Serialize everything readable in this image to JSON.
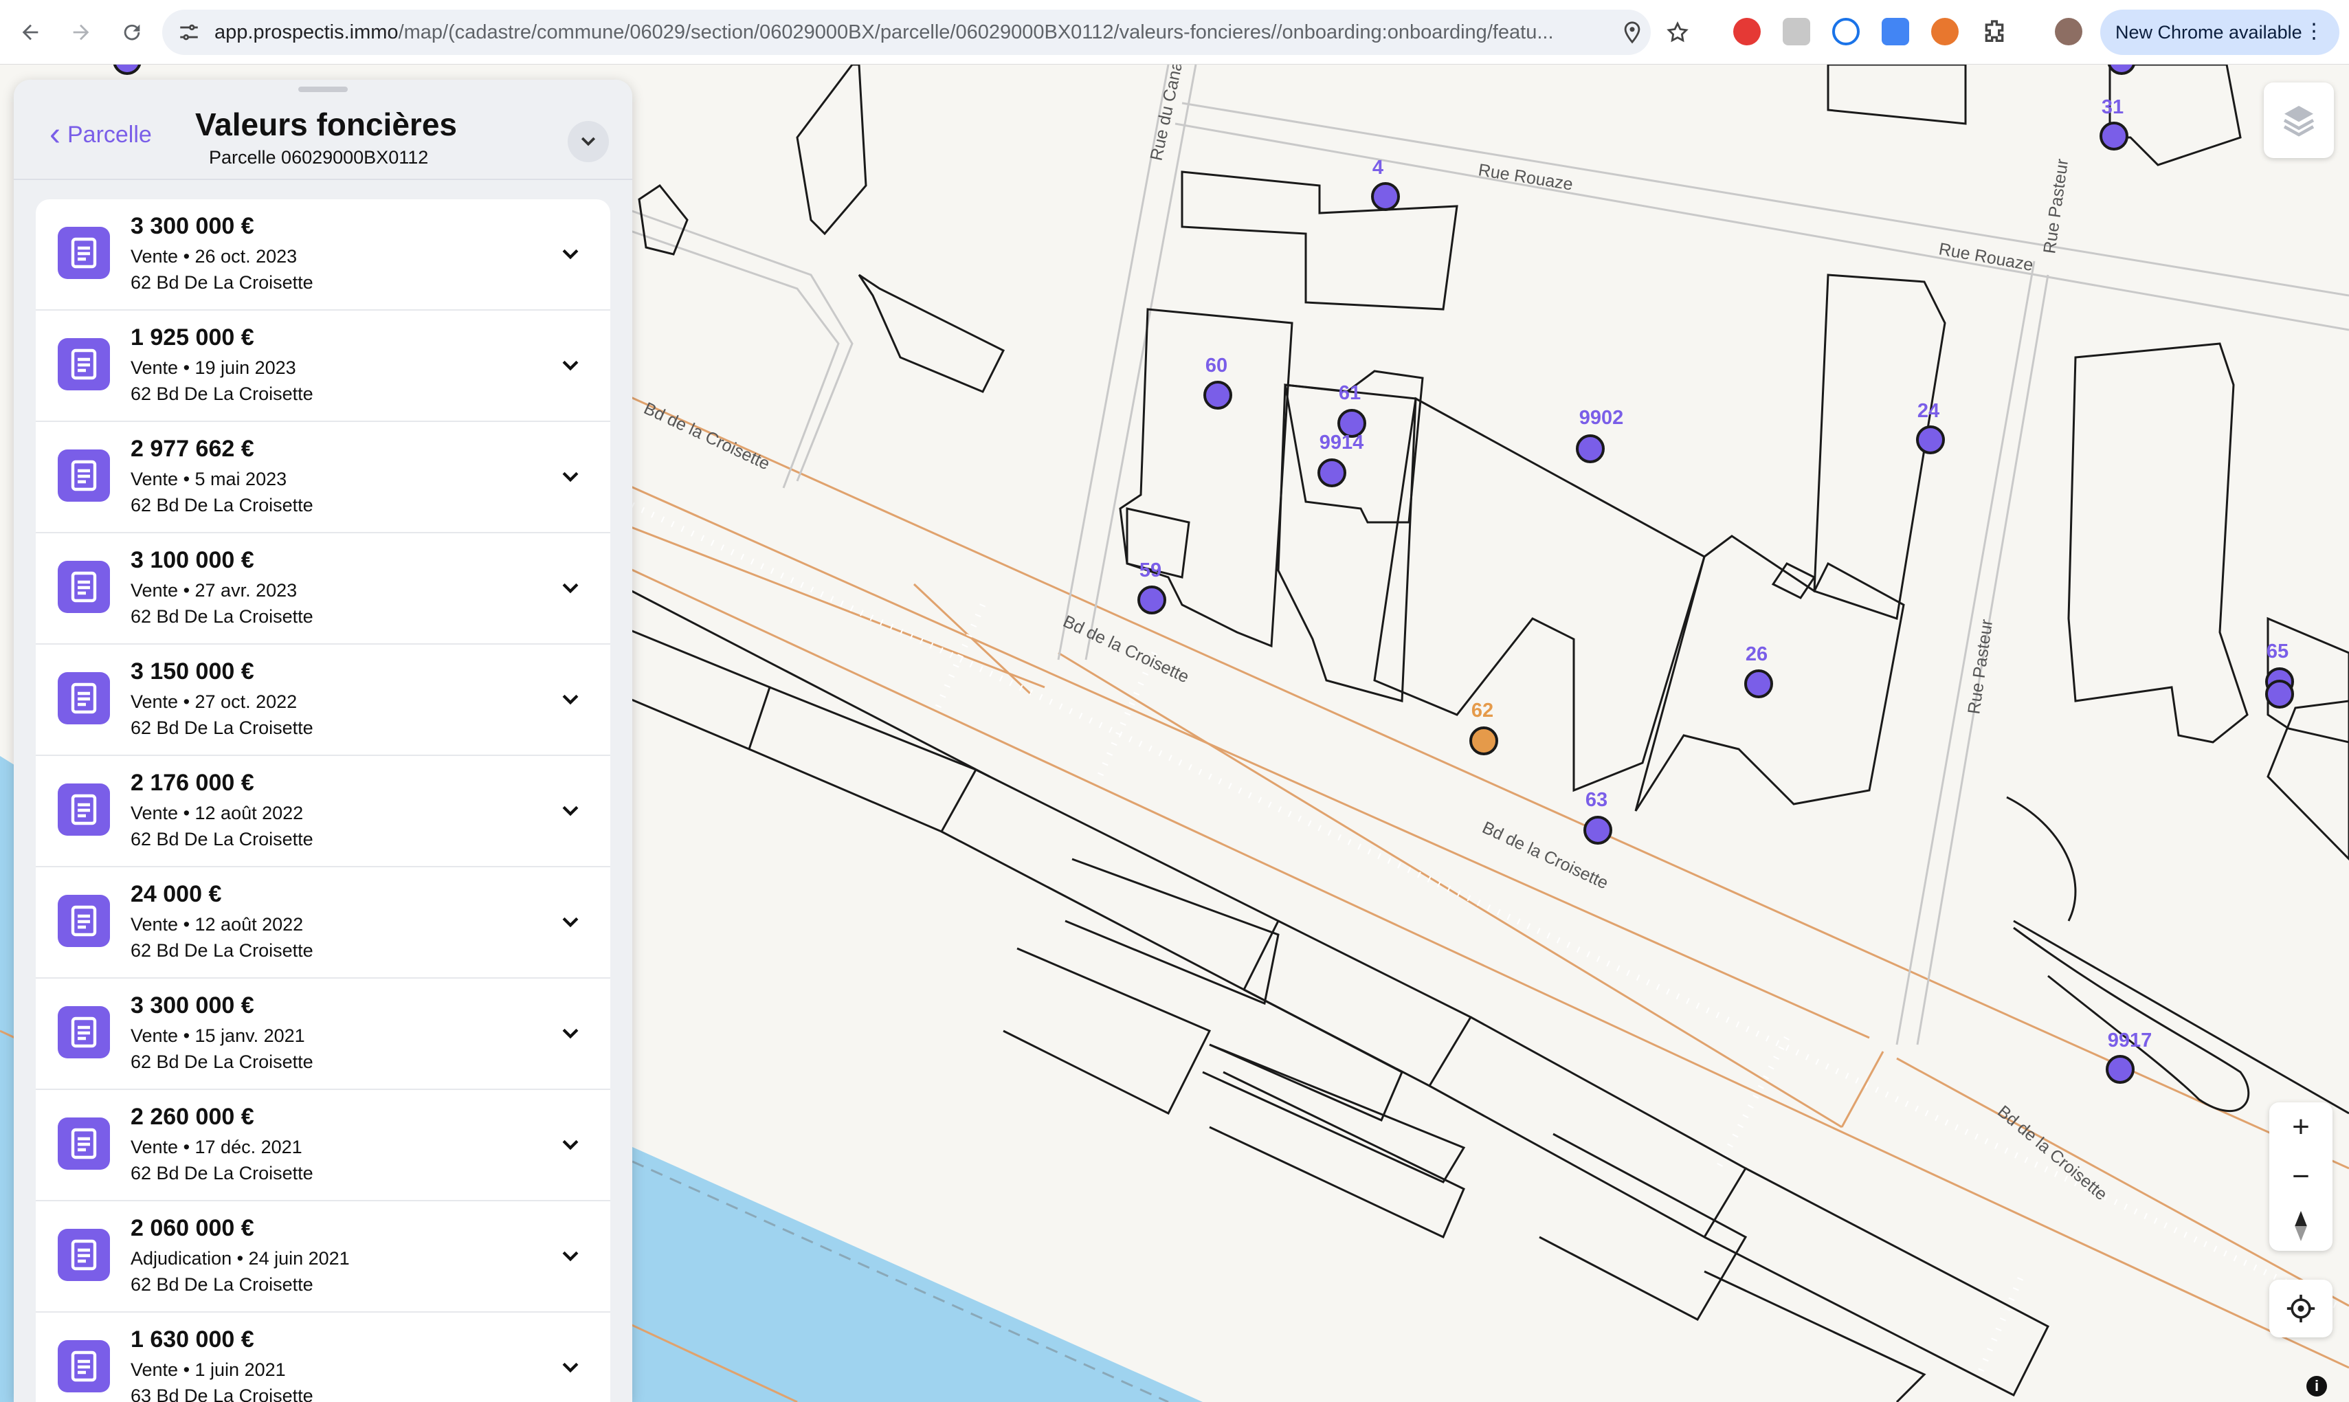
{
  "browser": {
    "url_host": "app.prospectis.immo",
    "url_path": "/map/(cadastre/commune/06029/section/06029000BX/parcelle/06029000BX0112/valeurs-foncieres//onboarding:onboarding/featu...",
    "update_label": "New Chrome available",
    "icons": [
      "back-arrow-icon",
      "forward-arrow-icon",
      "reload-icon",
      "site-settings-icon",
      "location-icon",
      "star-icon",
      "extension-icons",
      "puzzle-icon",
      "profile-avatar",
      "menu-dots-icon"
    ]
  },
  "panel": {
    "back_label": "Parcelle",
    "title": "Valeurs foncières",
    "subtitle": "Parcelle 06029000BX0112",
    "accent_color": "#7a5ee8",
    "transactions": [
      {
        "price": "3 300 000 €",
        "meta": "Vente • 26 oct. 2023",
        "address": "62 Bd De La Croisette"
      },
      {
        "price": "1 925 000 €",
        "meta": "Vente • 19 juin 2023",
        "address": "62 Bd De La Croisette"
      },
      {
        "price": "2 977 662 €",
        "meta": "Vente • 5 mai 2023",
        "address": "62 Bd De La Croisette"
      },
      {
        "price": "3 100 000 €",
        "meta": "Vente • 27 avr. 2023",
        "address": "62 Bd De La Croisette"
      },
      {
        "price": "3 150 000 €",
        "meta": "Vente • 27 oct. 2022",
        "address": "62 Bd De La Croisette"
      },
      {
        "price": "2 176 000 €",
        "meta": "Vente • 12 août 2022",
        "address": "62 Bd De La Croisette"
      },
      {
        "price": "24 000 €",
        "meta": "Vente • 12 août 2022",
        "address": "62 Bd De La Croisette"
      },
      {
        "price": "3 300 000 €",
        "meta": "Vente • 15 janv. 2021",
        "address": "62 Bd De La Croisette"
      },
      {
        "price": "2 260 000 €",
        "meta": "Vente • 17 déc. 2021",
        "address": "62 Bd De La Croisette"
      },
      {
        "price": "2 060 000 €",
        "meta": "Adjudication • 24 juin 2021",
        "address": "62 Bd De La Croisette"
      },
      {
        "price": "1 630 000 €",
        "meta": "Vente • 1 juin 2021",
        "address": "63 Bd De La Croisette"
      }
    ]
  },
  "map": {
    "streets": [
      "Rue Rouaze",
      "Rue Rouaze",
      "Rue du Canada",
      "Rue Pasteur",
      "Rue Pasteur",
      "Bd de la Croisette",
      "Bd de la Croisette",
      "Bd de la Croisette",
      "Bd de la Croisette"
    ],
    "pins": [
      "4",
      "31",
      "60",
      "61",
      "9914",
      "9902",
      "24",
      "59",
      "26",
      "62",
      "63",
      "65",
      "9917"
    ],
    "selected_pin": "62",
    "pin_color": "#7a5ee8",
    "selected_pin_color": "#e59a4a",
    "water_color": "#9fd3ef",
    "controls": [
      "layers-icon",
      "zoom-in-icon",
      "zoom-out-icon",
      "compass-icon",
      "geolocate-icon",
      "info-icon"
    ]
  }
}
